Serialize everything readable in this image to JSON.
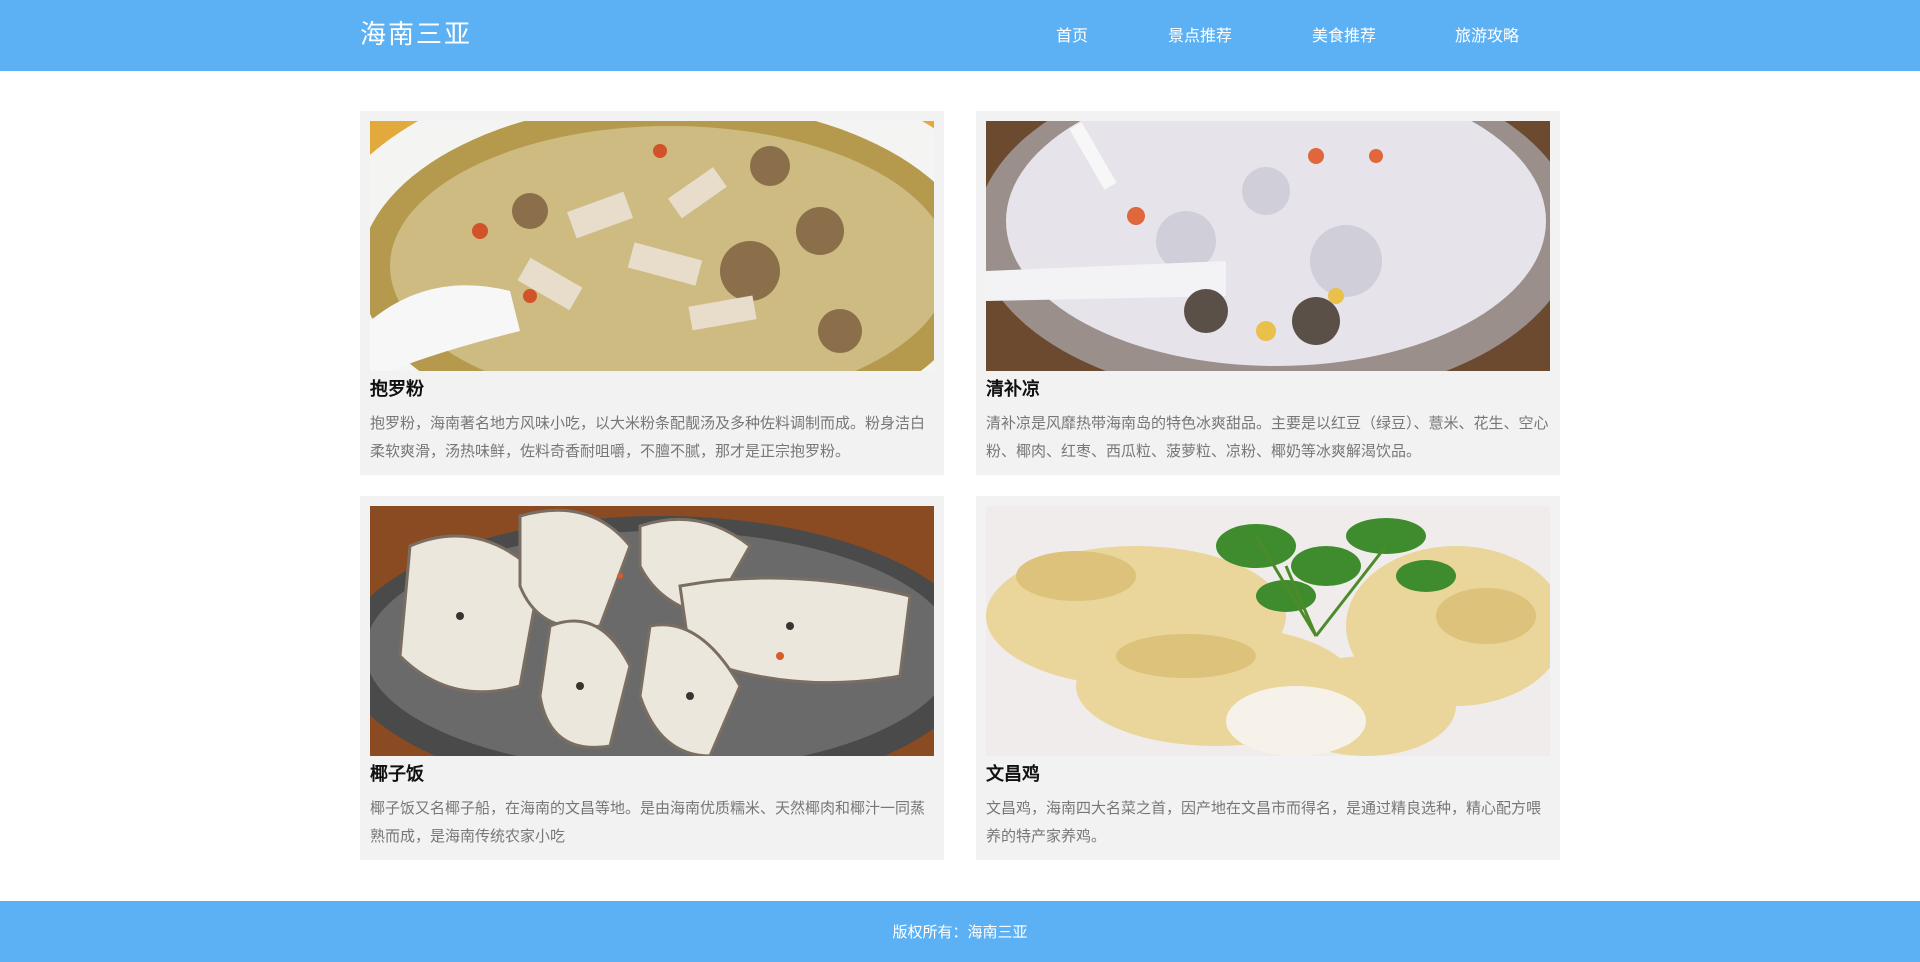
{
  "header": {
    "logo": "海南三亚",
    "nav": [
      "首页",
      "景点推荐",
      "美食推荐",
      "旅游攻略"
    ]
  },
  "cards": [
    {
      "title": "抱罗粉",
      "desc": "抱罗粉，海南著名地方风味小吃，以大米粉条配靓汤及多种佐料调制而成。粉身洁白柔软爽滑，汤热味鲜，佐料奇香耐咀嚼，不膻不腻，那才是正宗抱罗粉。",
      "image": "baoluo-noodle-photo"
    },
    {
      "title": "清补凉",
      "desc": "清补凉是风靡热带海南岛的特色冰爽甜品。主要是以红豆（绿豆）、薏米、花生、空心粉、椰肉、红枣、西瓜粒、菠萝粒、凉粉、椰奶等冰爽解渴饮品。",
      "image": "qingbuliang-dessert-photo"
    },
    {
      "title": "椰子饭",
      "desc": "椰子饭又名椰子船，在海南的文昌等地。是由海南优质糯米、天然椰肉和椰汁一同蒸熟而成，是海南传统农家小吃",
      "image": "coconut-rice-photo"
    },
    {
      "title": "文昌鸡",
      "desc": "文昌鸡，海南四大名菜之首，因产地在文昌市而得名，是通过精良选种，精心配方喂养的特产家养鸡。",
      "image": "wenchang-chicken-photo"
    }
  ],
  "footer": {
    "copyright": "版权所有：海南三亚"
  },
  "colors": {
    "accent": "#5cb1f4",
    "card_bg": "#f2f2f2",
    "desc_text": "#777777"
  }
}
